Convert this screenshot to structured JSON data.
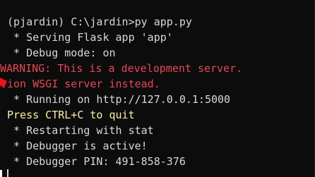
{
  "terminal": {
    "lines": [
      {
        "text": "(pjardin) C:\\jardin>py app.py",
        "color": "white"
      },
      {
        "text": " * Serving Flask app 'app'",
        "color": "white"
      },
      {
        "text": " * Debug mode: on",
        "color": "white"
      },
      {
        "text": "WARNING: This is a development server.",
        "color": "red"
      },
      {
        "text": "ion WSGI server instead.",
        "color": "red"
      },
      {
        "text": " * Running on http://127.0.0.1:5000",
        "color": "white"
      },
      {
        "text": "Press CTRL+C to quit",
        "color": "yellow"
      },
      {
        "text": " * Restarting with stat",
        "color": "white"
      },
      {
        "text": " * Debugger is active!",
        "color": "white"
      },
      {
        "text": " * Debugger PIN: 491-858-376",
        "color": "white"
      }
    ]
  },
  "colors": {
    "background": "#0c0c0c",
    "text": "#d8d8d8",
    "warning": "#e74856",
    "hint": "#f9f1a5",
    "annotation_arrow": "#e8141b"
  },
  "icons": {
    "annotation": "red-arrow-icon"
  }
}
